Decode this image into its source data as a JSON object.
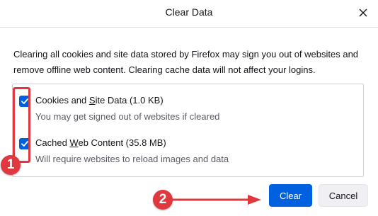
{
  "dialog": {
    "title": "Clear Data",
    "description": "Clearing all cookies and site data stored by Firefox may sign you out of websites and remove offline web content. Clearing cache data will not affect your logins."
  },
  "options": [
    {
      "label_before": "Cookies and ",
      "label_accel": "S",
      "label_after": "ite Data (1.0 KB)",
      "description": "You may get signed out of websites if cleared",
      "checked": true
    },
    {
      "label_before": "Cached ",
      "label_accel": "W",
      "label_after": "eb Content (35.8 MB)",
      "description": "Will require websites to reload images and data",
      "checked": true
    }
  ],
  "buttons": {
    "clear": "Clear",
    "cancel": "Cancel"
  },
  "annotations": {
    "step1": "1",
    "step2": "2"
  },
  "colors": {
    "accent": "#0061e0",
    "annotation": "#e0383e"
  }
}
